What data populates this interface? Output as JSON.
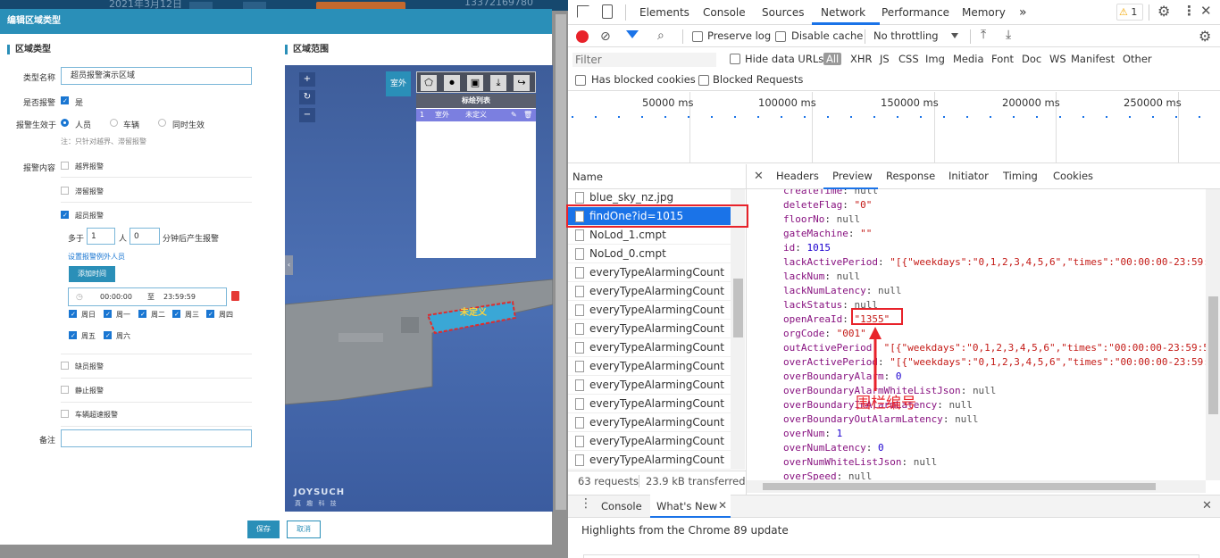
{
  "left_app": {
    "top_strip": {
      "date": "2021年3月12日",
      "phone": "13372169780"
    },
    "modal_title": "编辑区域类型",
    "section_zone_type": "区域类型",
    "section_zone_range": "区域范围",
    "type_name_label": "类型名称",
    "type_name_value": "超员报警演示区域",
    "is_alarm_label": "是否报警",
    "is_alarm_value": "是",
    "alarm_effect_label": "报警生效于",
    "alarm_targets": [
      "人员",
      "车辆",
      "同时生效"
    ],
    "alarm_note": "注：只针对越界、滞留报警",
    "alarm_content_label": "报警内容",
    "alarm_items": {
      "cross_boundary": "越界报警",
      "stay": "滞留报警",
      "overcrowd": "超员报警",
      "absent": "缺员报警",
      "stillness": "静止报警",
      "vehicle_speed": "车辆超速报警"
    },
    "overcrowd_more_than": "多于",
    "overcrowd_count": "1",
    "overcrowd_unit": "人",
    "overcrowd_minutes": "0",
    "overcrowd_suffix": "分钟后产生报警",
    "exception_link": "设置报警例外人员",
    "add_time_button": "添加时间",
    "time_start": "00:00:00",
    "time_to": "至",
    "time_end": "23:59:59",
    "weekdays": [
      "周日",
      "周一",
      "周二",
      "周三",
      "周四",
      "周五",
      "周六"
    ],
    "remark_label": "备注",
    "save_button": "保存",
    "cancel_button": "取消",
    "map": {
      "outdoor_button": "室外",
      "plus": "+",
      "refresh": "↻",
      "minus": "−",
      "plot_list_title": "标绘列表",
      "plot_row": {
        "index": "1",
        "type": "室外",
        "name": "未定义"
      },
      "area_label": "未定义",
      "logo": "JOYSUCH",
      "logo_sub": "真 趣 科 技"
    }
  },
  "devtools": {
    "tabs": [
      "Elements",
      "Console",
      "Sources",
      "Network",
      "Performance",
      "Memory"
    ],
    "active_tab": "Network",
    "warning_count": "1",
    "preserve_log": "Preserve log",
    "disable_cache": "Disable cache",
    "throttling": "No throttling",
    "filter_placeholder": "Filter",
    "hide_data_urls": "Hide data URLs",
    "filter_types": [
      "All",
      "XHR",
      "JS",
      "CSS",
      "Img",
      "Media",
      "Font",
      "Doc",
      "WS",
      "Manifest",
      "Other"
    ],
    "has_blocked_cookies": "Has blocked cookies",
    "blocked_requests": "Blocked Requests",
    "timeline_ticks": [
      "50000 ms",
      "100000 ms",
      "150000 ms",
      "200000 ms",
      "250000 ms"
    ],
    "name_header": "Name",
    "requests": [
      "blue_sky_nz.jpg",
      "findOne?id=1015",
      "NoLod_1.cmpt",
      "NoLod_0.cmpt",
      "everyTypeAlarmingCount",
      "everyTypeAlarmingCount",
      "everyTypeAlarmingCount",
      "everyTypeAlarmingCount",
      "everyTypeAlarmingCount",
      "everyTypeAlarmingCount",
      "everyTypeAlarmingCount",
      "everyTypeAlarmingCount",
      "everyTypeAlarmingCount",
      "everyTypeAlarmingCount",
      "everyTypeAlarmingCount"
    ],
    "selected_request": "findOne?id=1015",
    "detail_tabs": [
      "Headers",
      "Preview",
      "Response",
      "Initiator",
      "Timing",
      "Cookies"
    ],
    "active_detail_tab": "Preview",
    "preview_lines": [
      {
        "key": "createTime",
        "val": "null",
        "kind": "null"
      },
      {
        "key": "deleteFlag",
        "val": "\"0\"",
        "kind": "str"
      },
      {
        "key": "floorNo",
        "val": "null",
        "kind": "null"
      },
      {
        "key": "gateMachine",
        "val": "\"\"",
        "kind": "str"
      },
      {
        "key": "id",
        "val": "1015",
        "kind": "num"
      },
      {
        "key": "lackActivePeriod",
        "val": "\"[{\"weekdays\":\"0,1,2,3,4,5,6\",\"times\":\"00:00:00-23:59:",
        "kind": "str"
      },
      {
        "key": "lackNum",
        "val": "null",
        "kind": "null"
      },
      {
        "key": "lackNumLatency",
        "val": "null",
        "kind": "null"
      },
      {
        "key": "lackStatus",
        "val": "null",
        "kind": "null"
      },
      {
        "key": "openAreaId",
        "val": "\"1355\"",
        "kind": "str"
      },
      {
        "key": "orgCode",
        "val": "\"001\"",
        "kind": "str"
      },
      {
        "key": "outActivePeriod",
        "val": "\"[{\"weekdays\":\"0,1,2,3,4,5,6\",\"times\":\"00:00:00-23:59:5",
        "kind": "str"
      },
      {
        "key": "overActivePeriod",
        "val": "\"[{\"weekdays\":\"0,1,2,3,4,5,6\",\"times\":\"00:00:00-23:59:",
        "kind": "str"
      },
      {
        "key": "overBoundaryAlarm",
        "val": "0",
        "kind": "num"
      },
      {
        "key": "overBoundaryAlarmWhiteListJson",
        "val": "null",
        "kind": "null"
      },
      {
        "key": "overBoundaryInAlarmLatency",
        "val": "null",
        "kind": "null"
      },
      {
        "key": "overBoundaryOutAlarmLatency",
        "val": "null",
        "kind": "null"
      },
      {
        "key": "overNum",
        "val": "1",
        "kind": "num"
      },
      {
        "key": "overNumLatency",
        "val": "0",
        "kind": "num"
      },
      {
        "key": "overNumWhiteListJson",
        "val": "null",
        "kind": "null"
      },
      {
        "key": "overSpeed",
        "val": "null",
        "kind": "null"
      }
    ],
    "annotation_text": "围栏编号",
    "requests_count": "63 requests",
    "transferred": "23.9 kB transferred",
    "drawer_tabs": [
      "Console",
      "What's New"
    ],
    "drawer_text": "Highlights from the Chrome 89 update",
    "accent": "#1a73e8",
    "annotation_color": "#e8222a"
  }
}
